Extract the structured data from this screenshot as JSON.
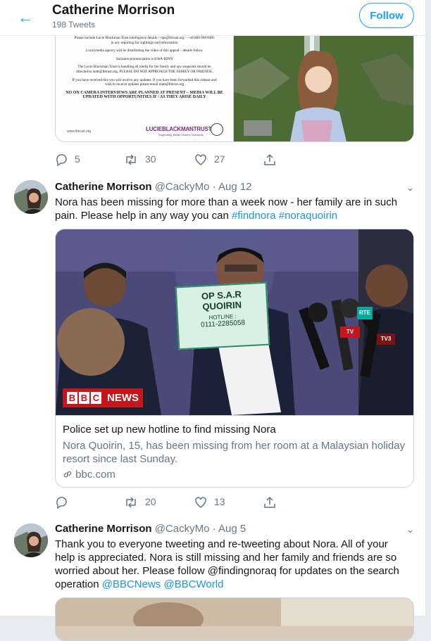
{
  "header": {
    "name": "Catherine Morrison",
    "tweet_count": "198 Tweets",
    "follow_label": "Follow"
  },
  "colors": {
    "accent": "#1da1f2",
    "muted": "#657786",
    "bbc_red": "#c4161c"
  },
  "tweet0": {
    "poster": {
      "lines": [
        "Please include Lucie Blackman Trust intelligence details – ops@lbtrust.org – +44 800 098 8485",
        "in any reporting for sightings and information",
        "Local media agency will be distributing the video of this appeal – details follow",
        "Surname pronunciation is KWA-RINN",
        "The Lucie Blackman Trust is handling all media for the family and any enquiries should be",
        "directed to matt@lbtrust.org. PLEASE DO NOT APPROACH THE FAMILY OR FRIENDS.",
        "If you have received this you will receive any updates. If you have been forwarded this release and",
        "wish to receive updates please email matt@lbtrust.org",
        "NO ON CAMERA INTERVIEWS ARE PLANNED AT PRESENT – MEDIA WILL BE",
        "UPDATED WITH OPPORTUNITIES IF / AS THEY ARISE DAILY"
      ],
      "website": "www.lbtrust.org",
      "logo": "LUCIEBLACKMANTRUST",
      "logo_sub": "Supporting British Victims Overseas"
    },
    "stats": {
      "replies": "5",
      "retweets": "30",
      "likes": "27"
    }
  },
  "tweet1": {
    "name": "Catherine Morrison",
    "handle": "@CackyMo",
    "dot": "·",
    "date": "Aug 12",
    "text": "Nora has been missing for more than a week now - her family are in such pain. Please help in any way you can ",
    "hashtag1": "#findnora",
    "hashtag2": "#noraquoirin",
    "image": {
      "sign_line1": "OP S.A.R",
      "sign_line2": "QUOIRIN",
      "sign_line3": "HOTLINE :",
      "sign_line4": "0111-2285058",
      "bbc": "BBC",
      "news": "NEWS",
      "mic1": "TV",
      "mic2": "RTE",
      "mic3": "TV3"
    },
    "card": {
      "title": "Police set up new hotline to find missing Nora",
      "description": "Nora Quoirin, 15, has been missing from her room at a Malaysian holiday resort since last Sunday.",
      "domain": "bbc.com"
    },
    "stats": {
      "replies": "",
      "retweets": "20",
      "likes": "13"
    }
  },
  "tweet2": {
    "name": "Catherine Morrison",
    "handle": "@CackyMo",
    "dot": "·",
    "date": "Aug 5",
    "text": "Thank you to everyone tweeting and re-tweeting about Nora. All of your help is appreciated. Nora is still missing and her family and friends are so worried about her. Please follow @findingnoraq for updates on the search operation ",
    "mention1": "@BBCNews",
    "mention2": "@BBCWorld"
  }
}
